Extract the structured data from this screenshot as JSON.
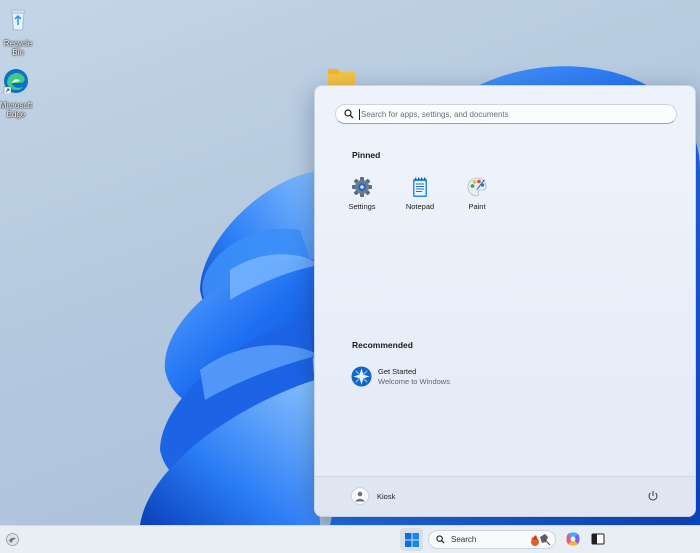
{
  "desktop": {
    "icons": [
      {
        "label": "Recycle Bin",
        "icon": "recycle-bin-icon"
      },
      {
        "label": "Microsoft Edge",
        "icon": "edge-icon"
      }
    ]
  },
  "start_menu": {
    "search": {
      "placeholder": "Search for apps, settings, and documents"
    },
    "pinned": {
      "title": "Pinned",
      "apps": [
        {
          "label": "Settings",
          "icon": "gear-icon"
        },
        {
          "label": "Notepad",
          "icon": "notepad-icon"
        },
        {
          "label": "Paint",
          "icon": "paint-palette-icon"
        }
      ]
    },
    "recommended": {
      "title": "Recommended",
      "items": [
        {
          "title": "Get Started",
          "subtitle": "Welcome to Windows",
          "icon": "get-started-icon"
        }
      ]
    },
    "footer": {
      "user_name": "Kiosk",
      "power_icon": "power-icon"
    }
  },
  "taskbar": {
    "search_label": "Search",
    "items": [
      "widgets-icon",
      "windows-start-icon",
      "search-icon",
      "copilot-icon",
      "task-view-icon"
    ]
  },
  "colors": {
    "accent": "#0067c0",
    "wallpaper_bloom": "#1a6ef0",
    "start_menu_bg": "#eef3fb",
    "taskbar_bg": "#e9eef5"
  }
}
